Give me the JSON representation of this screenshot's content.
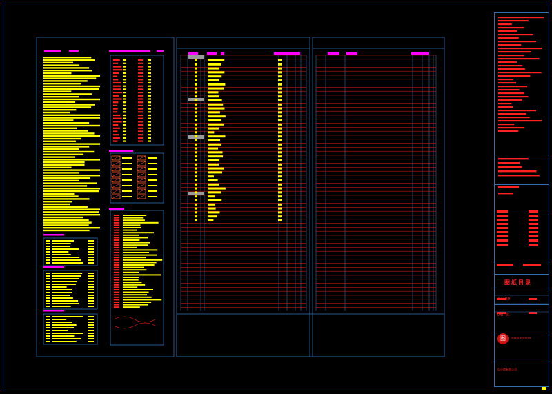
{
  "drawing": {
    "title": "图纸目录",
    "scale": "1:100",
    "drawing_no": "DWT-01",
    "seal_text": "图",
    "company_mark": "DESIGN INSTITUTE",
    "company_bottom": "设计院有限公司"
  },
  "colors": {
    "frame": "#2f6fb0",
    "text_yellow": "#ffff00",
    "text_red": "#ff2020",
    "header_magenta": "#ff00ff",
    "row_line": "#c01818",
    "gray_cell": "#9a9a9a"
  }
}
